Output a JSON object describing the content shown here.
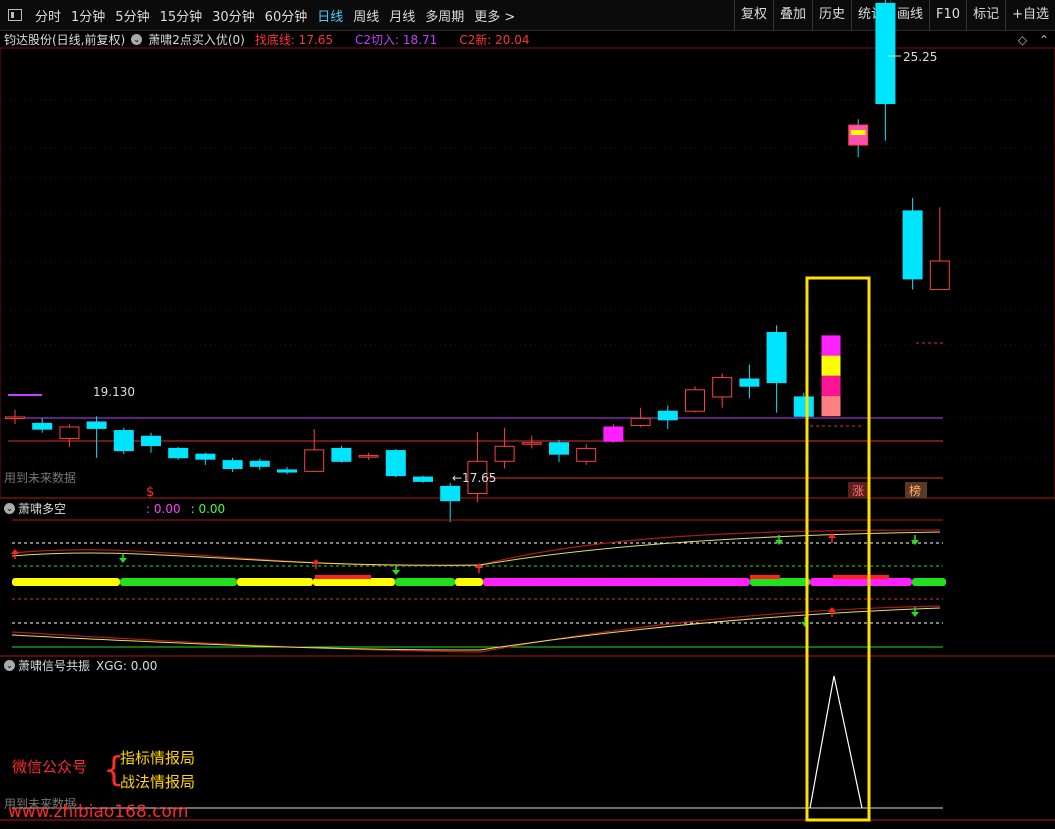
{
  "toolbar": {
    "periods": [
      "分时",
      "1分钟",
      "5分钟",
      "15分钟",
      "30分钟",
      "60分钟",
      "日线",
      "周线",
      "月线",
      "多周期",
      "更多 >"
    ],
    "active_period": "日线",
    "right_buttons": [
      "复权",
      "叠加",
      "历史",
      "统计",
      "画线",
      "F10",
      "标记",
      "+自选"
    ]
  },
  "info": {
    "stock": "钧达股份(日线,前复权)",
    "indicator": "萧啸2点买入优(0)",
    "low_line_label": "找底线: 17.65",
    "c2_entry_label": "C2切入: 18.71",
    "c2_new_label": "C2新: 20.04",
    "colors": {
      "low": "#ff3333",
      "c2entry": "#c040ff",
      "c2new": "#ff3333"
    }
  },
  "price_panel": {
    "high_label": "25.25",
    "low_label": "17.65",
    "mid_label": "19.130",
    "future_note": "用到未来数据",
    "badges": [
      "涨",
      "榜"
    ],
    "marker_s": "$"
  },
  "panel2": {
    "title": "萧啸多空",
    "v1": ": 0.00",
    "v2": ": 0.00"
  },
  "panel3": {
    "title": "萧啸信号共振",
    "value": "XGG: 0.00",
    "future_note": "用到未来数据"
  },
  "watermark": {
    "wechat": "微信公众号",
    "line1": "指标情报局",
    "line2": "战法情报局",
    "site": "www.zhibiao168.com"
  },
  "chart_data": {
    "type": "candlestick",
    "up_color": "#ff4040",
    "down_color": "#00e5ff",
    "candles": [
      {
        "o": 19.12,
        "c": 19.12,
        "h": 19.22,
        "l": 19.02
      },
      {
        "o": 19.03,
        "c": 18.95,
        "h": 19.1,
        "l": 18.9
      },
      {
        "o": 18.82,
        "c": 18.98,
        "h": 19.02,
        "l": 18.7
      },
      {
        "o": 19.05,
        "c": 18.96,
        "h": 19.13,
        "l": 18.55
      },
      {
        "o": 18.93,
        "c": 18.65,
        "h": 18.97,
        "l": 18.6
      },
      {
        "o": 18.85,
        "c": 18.72,
        "h": 18.9,
        "l": 18.62
      },
      {
        "o": 18.68,
        "c": 18.55,
        "h": 18.7,
        "l": 18.52
      },
      {
        "o": 18.6,
        "c": 18.53,
        "h": 18.62,
        "l": 18.45
      },
      {
        "o": 18.51,
        "c": 18.4,
        "h": 18.55,
        "l": 18.35
      },
      {
        "o": 18.5,
        "c": 18.43,
        "h": 18.54,
        "l": 18.38
      },
      {
        "o": 18.38,
        "c": 18.35,
        "h": 18.42,
        "l": 18.32
      },
      {
        "o": 18.36,
        "c": 18.66,
        "h": 18.95,
        "l": 18.35
      },
      {
        "o": 18.68,
        "c": 18.5,
        "h": 18.72,
        "l": 18.48
      },
      {
        "o": 18.58,
        "c": 18.58,
        "h": 18.62,
        "l": 18.52
      },
      {
        "o": 18.65,
        "c": 18.3,
        "h": 18.67,
        "l": 18.28
      },
      {
        "o": 18.28,
        "c": 18.22,
        "h": 18.3,
        "l": 18.2
      },
      {
        "o": 18.15,
        "c": 17.95,
        "h": 18.2,
        "l": 17.65
      },
      {
        "o": 18.05,
        "c": 18.5,
        "h": 18.91,
        "l": 17.93
      },
      {
        "o": 18.5,
        "c": 18.71,
        "h": 18.97,
        "l": 18.4
      },
      {
        "o": 18.76,
        "c": 18.76,
        "h": 18.86,
        "l": 18.68
      },
      {
        "o": 18.76,
        "c": 18.6,
        "h": 18.8,
        "l": 18.49
      },
      {
        "o": 18.5,
        "c": 18.68,
        "h": 18.74,
        "l": 18.45
      },
      {
        "o": 18.78,
        "c": 18.98,
        "h": 19.02,
        "l": 18.76
      },
      {
        "o": 19.0,
        "c": 19.1,
        "h": 19.25,
        "l": 18.98
      },
      {
        "o": 19.2,
        "c": 19.08,
        "h": 19.28,
        "l": 18.95
      },
      {
        "o": 19.2,
        "c": 19.5,
        "h": 19.55,
        "l": 19.18
      },
      {
        "o": 19.4,
        "c": 19.67,
        "h": 19.73,
        "l": 19.25
      },
      {
        "o": 19.65,
        "c": 19.55,
        "h": 19.85,
        "l": 19.38
      },
      {
        "o": 20.3,
        "c": 19.6,
        "h": 20.4,
        "l": 19.18
      },
      {
        "o": 19.4,
        "c": 19.13,
        "h": 19.46,
        "l": 19.12
      },
      {
        "o": 19.13,
        "c": 20.26,
        "h": 20.26,
        "l": 19.13
      },
      {
        "o": 23.2,
        "c": 22.92,
        "h": 23.28,
        "l": 22.75
      },
      {
        "o": 24.9,
        "c": 23.5,
        "h": 25.25,
        "l": 22.98
      },
      {
        "o": 22.0,
        "c": 21.05,
        "h": 22.18,
        "l": 20.9
      },
      {
        "o": 20.9,
        "c": 21.3,
        "h": 22.05,
        "l": 20.9
      }
    ]
  }
}
